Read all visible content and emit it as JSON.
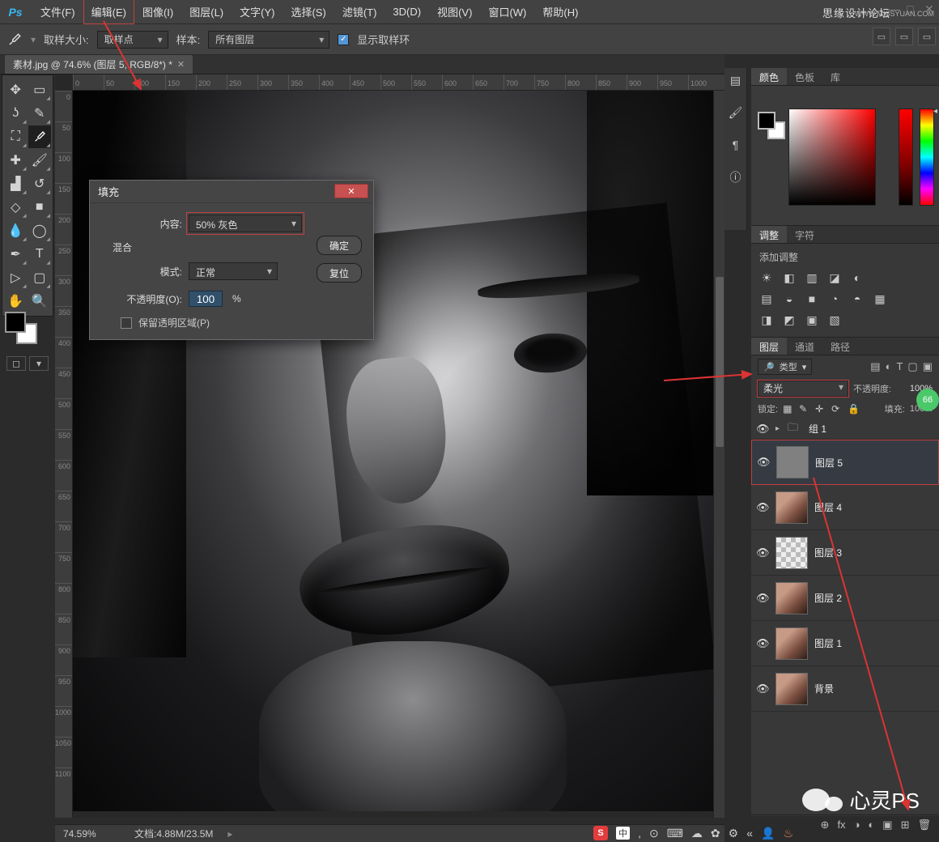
{
  "watermarks": {
    "site_top": "WWW.MISSYUAN.COM",
    "site_tag": "思缘设计论坛",
    "wechat_text": "心灵PS"
  },
  "menubar": {
    "logo": "Ps",
    "items": [
      "文件(F)",
      "编辑(E)",
      "图像(I)",
      "图层(L)",
      "文字(Y)",
      "选择(S)",
      "滤镜(T)",
      "3D(D)",
      "视图(V)",
      "窗口(W)",
      "帮助(H)"
    ],
    "highlight_index": 1
  },
  "options_bar": {
    "sample_size_label": "取样大小:",
    "sample_size_value": "取样点",
    "sample_label": "样本:",
    "sample_value": "所有图层",
    "show_ring_label": "显示取样环"
  },
  "document_tab": {
    "label": "素材.jpg @ 74.6% (图层 5, RGB/8*) *"
  },
  "rulers": {
    "top": [
      "0",
      "50",
      "100",
      "150",
      "200",
      "250",
      "300",
      "350",
      "400",
      "450",
      "500",
      "550",
      "600",
      "650",
      "700",
      "750",
      "800",
      "850",
      "900",
      "950",
      "1000"
    ],
    "left": [
      "0",
      "50",
      "100",
      "150",
      "200",
      "250",
      "300",
      "350",
      "400",
      "450",
      "500",
      "550",
      "600",
      "650",
      "700",
      "750",
      "800",
      "850",
      "900",
      "950",
      "1000",
      "1050",
      "1100"
    ]
  },
  "toolbox": {
    "tools": [
      "move",
      "marquee",
      "lasso",
      "quick-select",
      "crop",
      "eyedropper",
      "healing",
      "brush",
      "stamp",
      "history-brush",
      "eraser",
      "gradient",
      "blur",
      "dodge",
      "pen",
      "type",
      "path-select",
      "rectangle",
      "hand",
      "zoom"
    ],
    "selected": "eyedropper"
  },
  "fill_dialog": {
    "title": "填充",
    "content_label": "内容:",
    "content_value": "50% 灰色",
    "ok": "确定",
    "reset": "复位",
    "blend_group": "混合",
    "mode_label": "模式:",
    "mode_value": "正常",
    "opacity_label": "不透明度(O):",
    "opacity_value": "100",
    "opacity_unit": "%",
    "preserve_label": "保留透明区域(P)"
  },
  "color_panel": {
    "tabs": [
      "颜色",
      "色板",
      "库"
    ],
    "active": 0
  },
  "adjust_panel": {
    "tabs": [
      "调整",
      "字符"
    ],
    "active": 0,
    "title": "添加调整",
    "icons_row1": [
      "☀",
      "◧",
      "▥",
      "◪",
      "◐"
    ],
    "icons_row2": [
      "▤",
      "◒",
      "■",
      "◔",
      "◓",
      "▦"
    ],
    "icons_row3": [
      "◨",
      "◩",
      "▣",
      "▧"
    ]
  },
  "layers_panel": {
    "tabs": [
      "图层",
      "通道",
      "路径"
    ],
    "active": 0,
    "type_label": "类型",
    "type_filter_glyph": "🔎",
    "type_icons": [
      "▤",
      "◐",
      "T",
      "▢",
      "▣"
    ],
    "blend_mode": "柔光",
    "opacity_label": "不透明度:",
    "opacity_value": "100%",
    "lock_label": "锁定:",
    "lock_icons": [
      "▦",
      "✎",
      "✛",
      "⟳",
      "🔒"
    ],
    "fill_label": "填充:",
    "fill_value": "100%",
    "group": {
      "name": "组 1"
    },
    "layers": [
      {
        "name": "图层 5",
        "thumb": "gray",
        "selected": true
      },
      {
        "name": "图层 4",
        "thumb": "portrait",
        "selected": false
      },
      {
        "name": "图层 3",
        "thumb": "checker",
        "selected": false
      },
      {
        "name": "图层 2",
        "thumb": "portrait",
        "selected": false
      },
      {
        "name": "图层 1",
        "thumb": "portrait",
        "selected": false
      },
      {
        "name": "背景",
        "thumb": "portrait",
        "selected": false
      }
    ],
    "footer_icons": [
      "⊕",
      "fx",
      "◑",
      "◐",
      "▣",
      "⊞",
      "🗑"
    ]
  },
  "status_bar": {
    "zoom": "74.59%",
    "doc_label": "文档:",
    "doc_value": "4.88M/23.5M"
  },
  "systray": {
    "sogou": "S",
    "ime_cn": "中",
    "badge_66": "66"
  }
}
